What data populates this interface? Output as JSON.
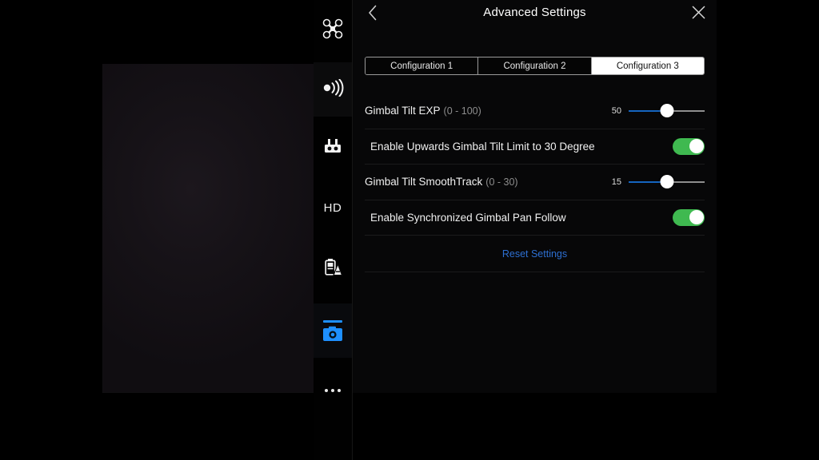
{
  "panel": {
    "title": "Advanced Settings",
    "back_icon": "chevron-left-icon",
    "close_icon": "close-icon",
    "tabs": [
      {
        "label": "Configuration 1",
        "selected": false
      },
      {
        "label": "Configuration 2",
        "selected": false
      },
      {
        "label": "Configuration 3",
        "selected": true
      }
    ],
    "rows": [
      {
        "type": "slider",
        "label": "Gimbal Tilt EXP",
        "range": "(0 - 100)",
        "value": "50",
        "min": 0,
        "max": 100,
        "fill_percent": 50
      },
      {
        "type": "toggle",
        "label": "Enable Upwards Gimbal Tilt Limit to 30 Degree",
        "value": "on"
      },
      {
        "type": "slider",
        "label": "Gimbal Tilt SmoothTrack",
        "range": "(0 - 30)",
        "value": "15",
        "min": 0,
        "max": 30,
        "fill_percent": 50
      },
      {
        "type": "toggle",
        "label": "Enable Synchronized Gimbal Pan Follow",
        "value": "on"
      }
    ],
    "reset_label": "Reset Settings"
  },
  "rail": {
    "items": [
      {
        "name": "aircraft-status-icon",
        "label": "",
        "icon": "drone-icon"
      },
      {
        "name": "signal-strength-icon",
        "label": "",
        "icon": "rc-signal-icon"
      },
      {
        "name": "remote-controller-icon",
        "label": "",
        "icon": "remote-controller-icon"
      },
      {
        "name": "video-quality-indicator",
        "label": "HD",
        "icon": "hd-text"
      },
      {
        "name": "battery-status-icon",
        "label": "",
        "icon": "battery-auto-icon"
      },
      {
        "name": "camera-settings-button",
        "label": "",
        "icon": "camera-icon",
        "active": true
      },
      {
        "name": "more-options-button",
        "label": "",
        "icon": "more-dots-icon"
      }
    ]
  },
  "colors": {
    "accent_blue": "#1e90ff",
    "slider_fill": "#1565c0",
    "toggle_on": "#3fb950",
    "link_blue": "#2d6fd1",
    "panel_bg": "#070708"
  }
}
